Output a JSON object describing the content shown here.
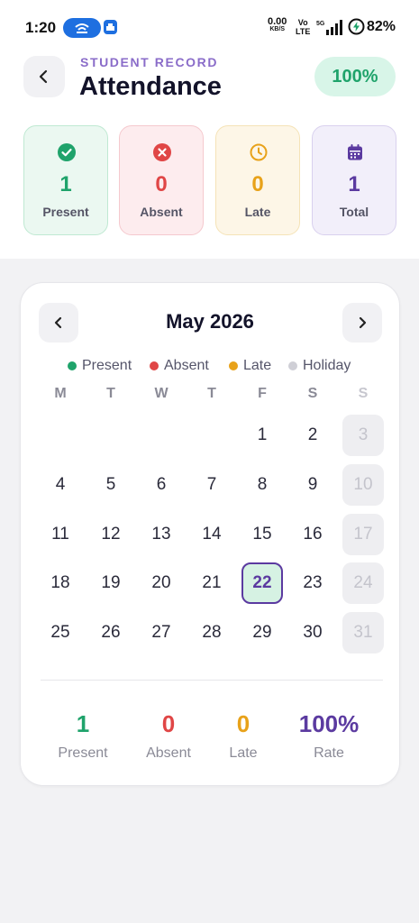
{
  "status_bar": {
    "time": "1:20",
    "speed_value": "0.00",
    "speed_unit": "KB/S",
    "volte_top": "Vo",
    "volte_bottom": "LTE",
    "network": "5G",
    "battery": "82%"
  },
  "header": {
    "eyebrow": "STUDENT RECORD",
    "title": "Attendance",
    "rate_badge": "100%",
    "back_icon": "chevron-left-icon"
  },
  "stats": [
    {
      "value": "1",
      "label": "Present",
      "icon": "check-circle-icon",
      "color": "#1fa36b"
    },
    {
      "value": "0",
      "label": "Absent",
      "icon": "x-circle-icon",
      "color": "#e04646"
    },
    {
      "value": "0",
      "label": "Late",
      "icon": "clock-icon",
      "color": "#e8a21a"
    },
    {
      "value": "1",
      "label": "Total",
      "icon": "calendar-icon",
      "color": "#5b3aa0"
    }
  ],
  "calendar": {
    "month_label": "May 2026",
    "legend": [
      {
        "label": "Present",
        "color": "#1fa36b"
      },
      {
        "label": "Absent",
        "color": "#e04646"
      },
      {
        "label": "Late",
        "color": "#e8a21a"
      },
      {
        "label": "Holiday",
        "color": "#cfcfd6"
      }
    ],
    "weekdays": [
      "M",
      "T",
      "W",
      "T",
      "F",
      "S",
      "S"
    ],
    "weeks": [
      [
        "",
        "",
        "",
        "",
        "1",
        "2",
        "3"
      ],
      [
        "4",
        "5",
        "6",
        "7",
        "8",
        "9",
        "10"
      ],
      [
        "11",
        "12",
        "13",
        "14",
        "15",
        "16",
        "17"
      ],
      [
        "18",
        "19",
        "20",
        "21",
        "22",
        "23",
        "24"
      ],
      [
        "25",
        "26",
        "27",
        "28",
        "29",
        "30",
        "31"
      ]
    ],
    "today": "22"
  },
  "summary": [
    {
      "value": "1",
      "label": "Present",
      "color": "#1fa36b"
    },
    {
      "value": "0",
      "label": "Absent",
      "color": "#e04646"
    },
    {
      "value": "0",
      "label": "Late",
      "color": "#e8a21a"
    },
    {
      "value": "100%",
      "label": "Rate",
      "color": "#5b3aa0"
    }
  ]
}
